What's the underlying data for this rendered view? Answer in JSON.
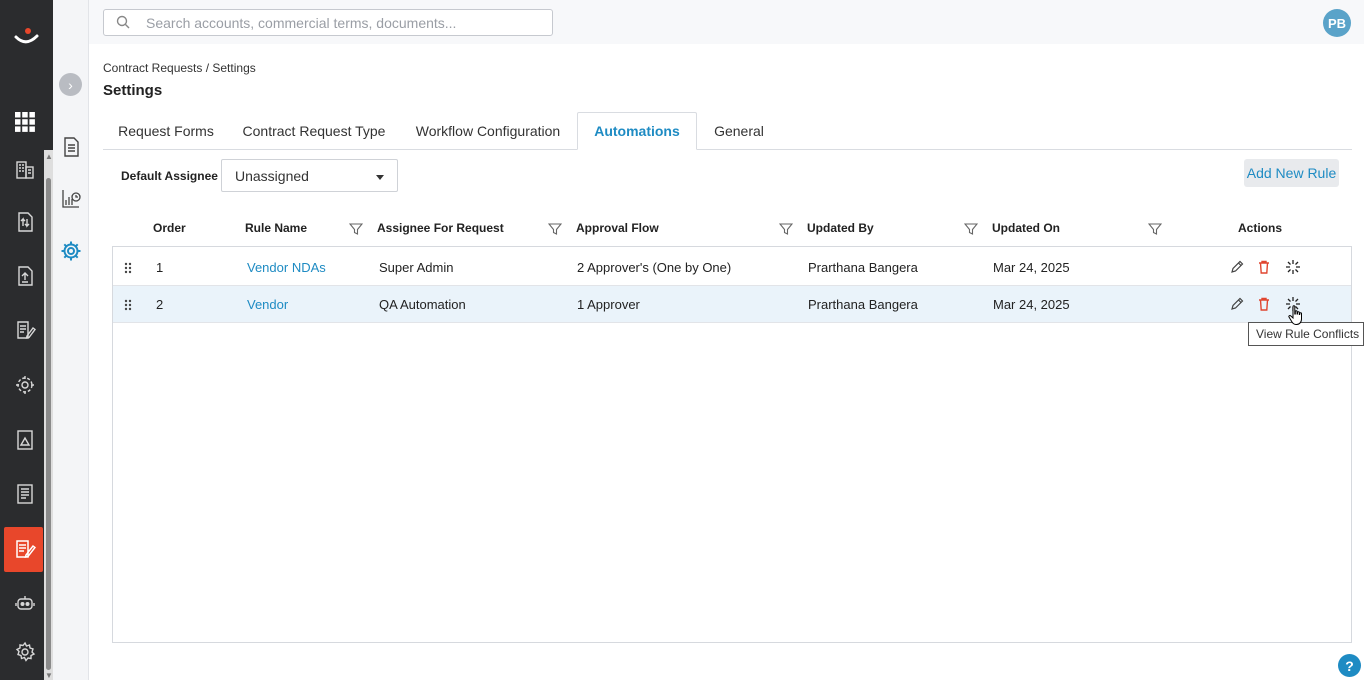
{
  "search": {
    "placeholder": "Search accounts, commercial terms, documents..."
  },
  "user": {
    "initials": "PB"
  },
  "breadcrumb": "Contract Requests / Settings",
  "page_title": "Settings",
  "tabs": [
    {
      "label": "Request Forms"
    },
    {
      "label": "Contract Request Type"
    },
    {
      "label": "Workflow Configuration"
    },
    {
      "label": "Automations"
    },
    {
      "label": "General"
    }
  ],
  "active_tab": "Automations",
  "default_assignee": {
    "label": "Default Assignee",
    "value": "Unassigned"
  },
  "add_rule_label": "Add New Rule",
  "table": {
    "columns": [
      "Order",
      "Rule Name",
      "Assignee For Request",
      "Approval Flow",
      "Updated By",
      "Updated On",
      "Actions"
    ],
    "rows": [
      {
        "order": "1",
        "rule_name": "Vendor NDAs",
        "assignee": "Super Admin",
        "approval_flow": "2 Approver's (One by One)",
        "updated_by": "Prarthana Bangera",
        "updated_on": "Mar 24, 2025"
      },
      {
        "order": "2",
        "rule_name": "Vendor",
        "assignee": "QA Automation",
        "approval_flow": "1 Approver",
        "updated_by": "Prarthana Bangera",
        "updated_on": "Mar 24, 2025"
      }
    ]
  },
  "tooltip": "View Rule Conflicts",
  "help_label": "?",
  "colors": {
    "accent": "#1e8bc3",
    "rail": "#2b2c2e",
    "active_nav": "#e8472b",
    "delete": "#e0452f",
    "row_highlight": "#eaf3fa"
  },
  "icons": {
    "rail": [
      "logo-icon",
      "grid-icon",
      "building-icon",
      "upload-doc-icon",
      "file-upload-icon",
      "edit-doc-icon",
      "gear-network-icon",
      "image-doc-icon",
      "document-icon",
      "contract-request-icon",
      "bot-icon",
      "settings-icon"
    ],
    "subnav": [
      "expand-icon",
      "document-list-icon",
      "report-icon",
      "settings-gear-icon"
    ],
    "row_actions": [
      "edit-icon",
      "delete-icon",
      "rule-conflicts-icon"
    ]
  }
}
